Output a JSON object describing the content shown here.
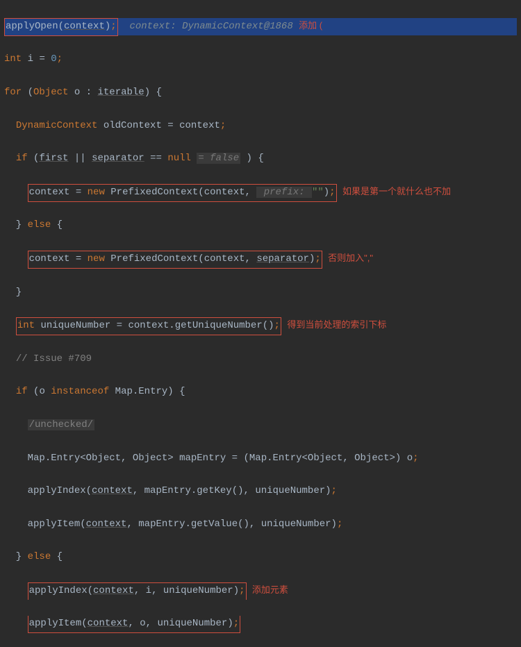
{
  "line1": {
    "call": "applyOpen",
    "arg": "context",
    "hint_label": "context:",
    "hint_val": "DynamicContext@1868",
    "annotation": "添加 ("
  },
  "line2": {
    "kw1": "int",
    "var": "i",
    "eq": "=",
    "val": "0"
  },
  "line3": {
    "kw": "for",
    "type": "Object",
    "var": "o",
    "iter": "iterable"
  },
  "line4": {
    "type": "DynamicContext",
    "var": "oldContext",
    "rhs": "context"
  },
  "line5": {
    "kw": "if",
    "a": "first",
    "or": "||",
    "b": "separator",
    "eq": "==",
    "c": "null",
    "hint": "= false"
  },
  "line6": {
    "lhs": "context",
    "kw": "new",
    "cls": "PrefixedContext",
    "arg1": "context",
    "hint_label": "prefix:",
    "hint_val": "\"\"",
    "annotation": "如果是第一个就什么也不加"
  },
  "line7": {
    "else": "else"
  },
  "line8": {
    "lhs": "context",
    "kw": "new",
    "cls": "PrefixedContext",
    "arg1": "context",
    "arg2": "separator",
    "annotation": "否则加入\",\""
  },
  "line9": {},
  "line10": {
    "type": "int",
    "var": "uniqueNumber",
    "rhs": "context",
    "method": "getUniqueNumber",
    "annotation": "得到当前处理的索引下标"
  },
  "line11": {
    "text": "// Issue #709"
  },
  "line12": {
    "kw": "if",
    "var": "o",
    "inst": "instanceof",
    "cls": "Map.Entry"
  },
  "line13": {
    "text": "/unchecked/"
  },
  "line14": {
    "a": "Map.Entry<Object, Object>",
    "var": "mapEntry",
    "cast": "(Map.Entry<Object, Object>)",
    "rhs": "o"
  },
  "line15": {
    "fn": "applyIndex",
    "a1": "context",
    "a2": "mapEntry",
    "m2": "getKey",
    "a3": "uniqueNumber"
  },
  "line16": {
    "fn": "applyItem",
    "a1": "context",
    "a2": "mapEntry",
    "m2": "getValue",
    "a3": "uniqueNumber"
  },
  "line17": {
    "else": "else"
  },
  "line18": {
    "fn": "applyIndex",
    "a1": "context",
    "a2": "i",
    "a3": "uniqueNumber",
    "annotation": "添加元素"
  },
  "line19": {
    "fn": "applyItem",
    "a1": "context",
    "a2": "o",
    "a3": "uniqueNumber"
  }
}
